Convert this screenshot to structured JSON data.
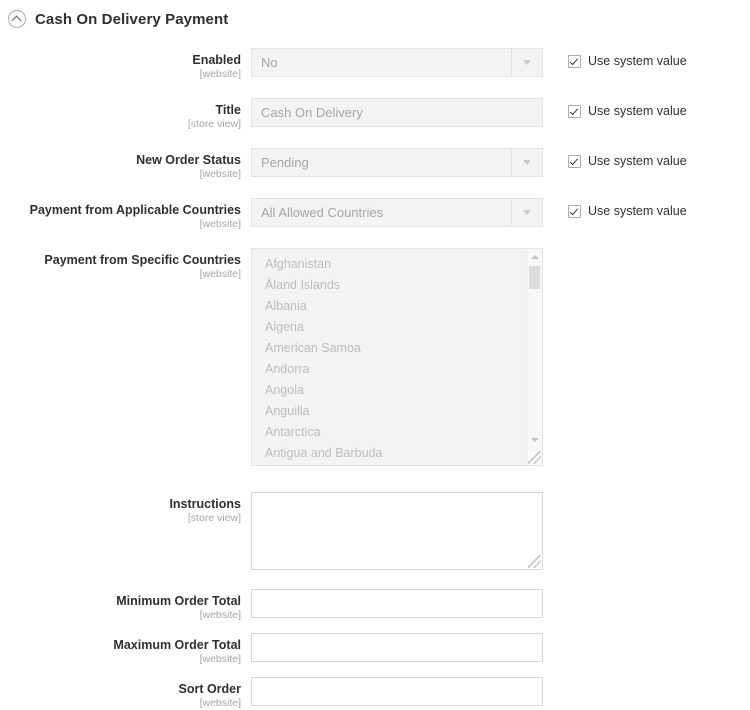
{
  "section": {
    "title": "Cash On Delivery Payment",
    "collapse_icon": "chevron-up-circle-icon",
    "expanded": true
  },
  "system_value_label": "Use system value",
  "fields": [
    {
      "id": "enabled",
      "label": "Enabled",
      "scope": "[website]",
      "type": "select",
      "value": "No",
      "disabled": true,
      "use_system_value": true
    },
    {
      "id": "title",
      "label": "Title",
      "scope": "[store view]",
      "type": "text-disabled",
      "value": "Cash On Delivery",
      "disabled": true,
      "use_system_value": true
    },
    {
      "id": "new_order_status",
      "label": "New Order Status",
      "scope": "[website]",
      "type": "select",
      "value": "Pending",
      "disabled": true,
      "use_system_value": true
    },
    {
      "id": "payment_from_applicable_countries",
      "label": "Payment from Applicable Countries",
      "scope": "[website]",
      "type": "select",
      "value": "All Allowed Countries",
      "disabled": true,
      "use_system_value": true
    },
    {
      "id": "payment_from_specific_countries",
      "label": "Payment from Specific Countries",
      "scope": "[website]",
      "type": "multiselect",
      "disabled": true,
      "use_system_value": false,
      "options": [
        "Afghanistan",
        "Åland Islands",
        "Albania",
        "Algeria",
        "American Samoa",
        "Andorra",
        "Angola",
        "Anguilla",
        "Antarctica",
        "Antigua and Barbuda"
      ]
    },
    {
      "id": "instructions",
      "label": "Instructions",
      "scope": "[store view]",
      "type": "textarea",
      "value": "",
      "disabled": false,
      "use_system_value": false
    },
    {
      "id": "minimum_order_total",
      "label": "Minimum Order Total",
      "scope": "[website]",
      "type": "text",
      "value": "",
      "disabled": false,
      "use_system_value": false
    },
    {
      "id": "maximum_order_total",
      "label": "Maximum Order Total",
      "scope": "[website]",
      "type": "text",
      "value": "",
      "disabled": false,
      "use_system_value": false
    },
    {
      "id": "sort_order",
      "label": "Sort Order",
      "scope": "[website]",
      "type": "text",
      "value": "",
      "disabled": false,
      "use_system_value": false
    }
  ],
  "colors": {
    "text": "#303030",
    "muted": "#a6a6a6",
    "disabled_bg": "#f3f3f3",
    "border": "#e3e3e3",
    "input_border": "#d6d6d6"
  }
}
